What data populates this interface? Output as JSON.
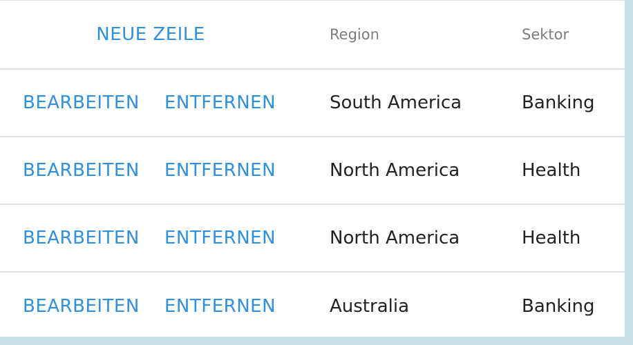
{
  "grid": {
    "toolbar": {
      "new_row_label": "NEUE ZEILE"
    },
    "columns": [
      {
        "label": "Region"
      },
      {
        "label": "Sektor"
      }
    ],
    "commands": {
      "edit_label": "BEARBEITEN",
      "remove_label": "ENTFERNEN"
    },
    "rows": [
      {
        "region": "South America",
        "sector": "Banking"
      },
      {
        "region": "North America",
        "sector": "Health"
      },
      {
        "region": "North America",
        "sector": "Health"
      },
      {
        "region": "Australia",
        "sector": "Banking"
      }
    ]
  },
  "colors": {
    "accent": "#2f8fe0",
    "header_text": "#7b7b7b",
    "cell_text": "#222222",
    "divider": "#e0e0e0",
    "backdrop": "#c7dfe6"
  }
}
